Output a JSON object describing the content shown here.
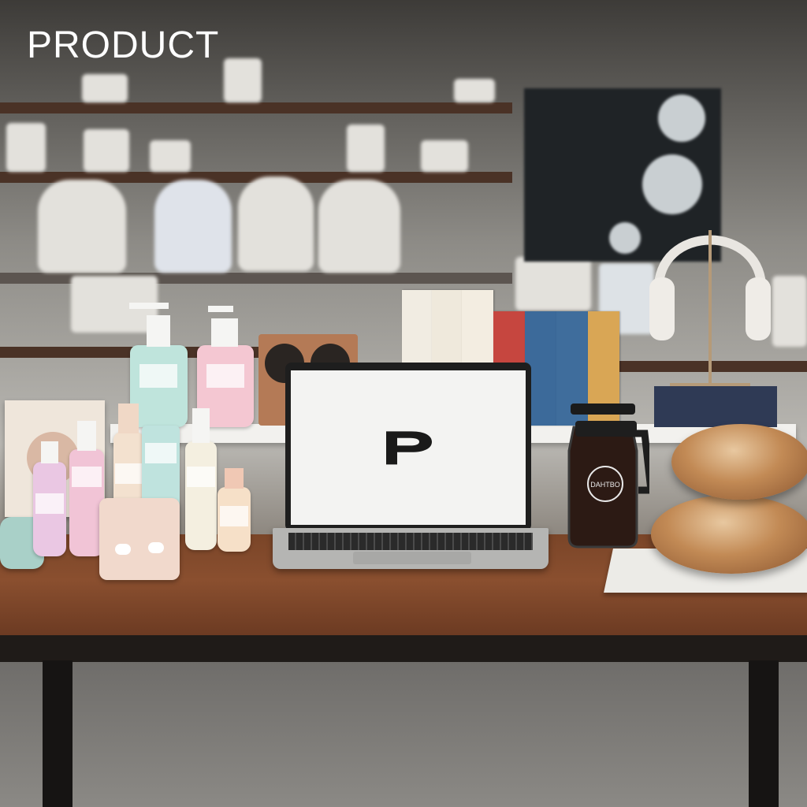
{
  "title": "PRODUCT",
  "scene": {
    "laptop_logo": "P",
    "carafe_label": "DAHTBO",
    "colors": {
      "title_text": "#ffffff",
      "tabletop": "#8a4f2f",
      "laptop_screen": "#f3f3f2"
    }
  }
}
